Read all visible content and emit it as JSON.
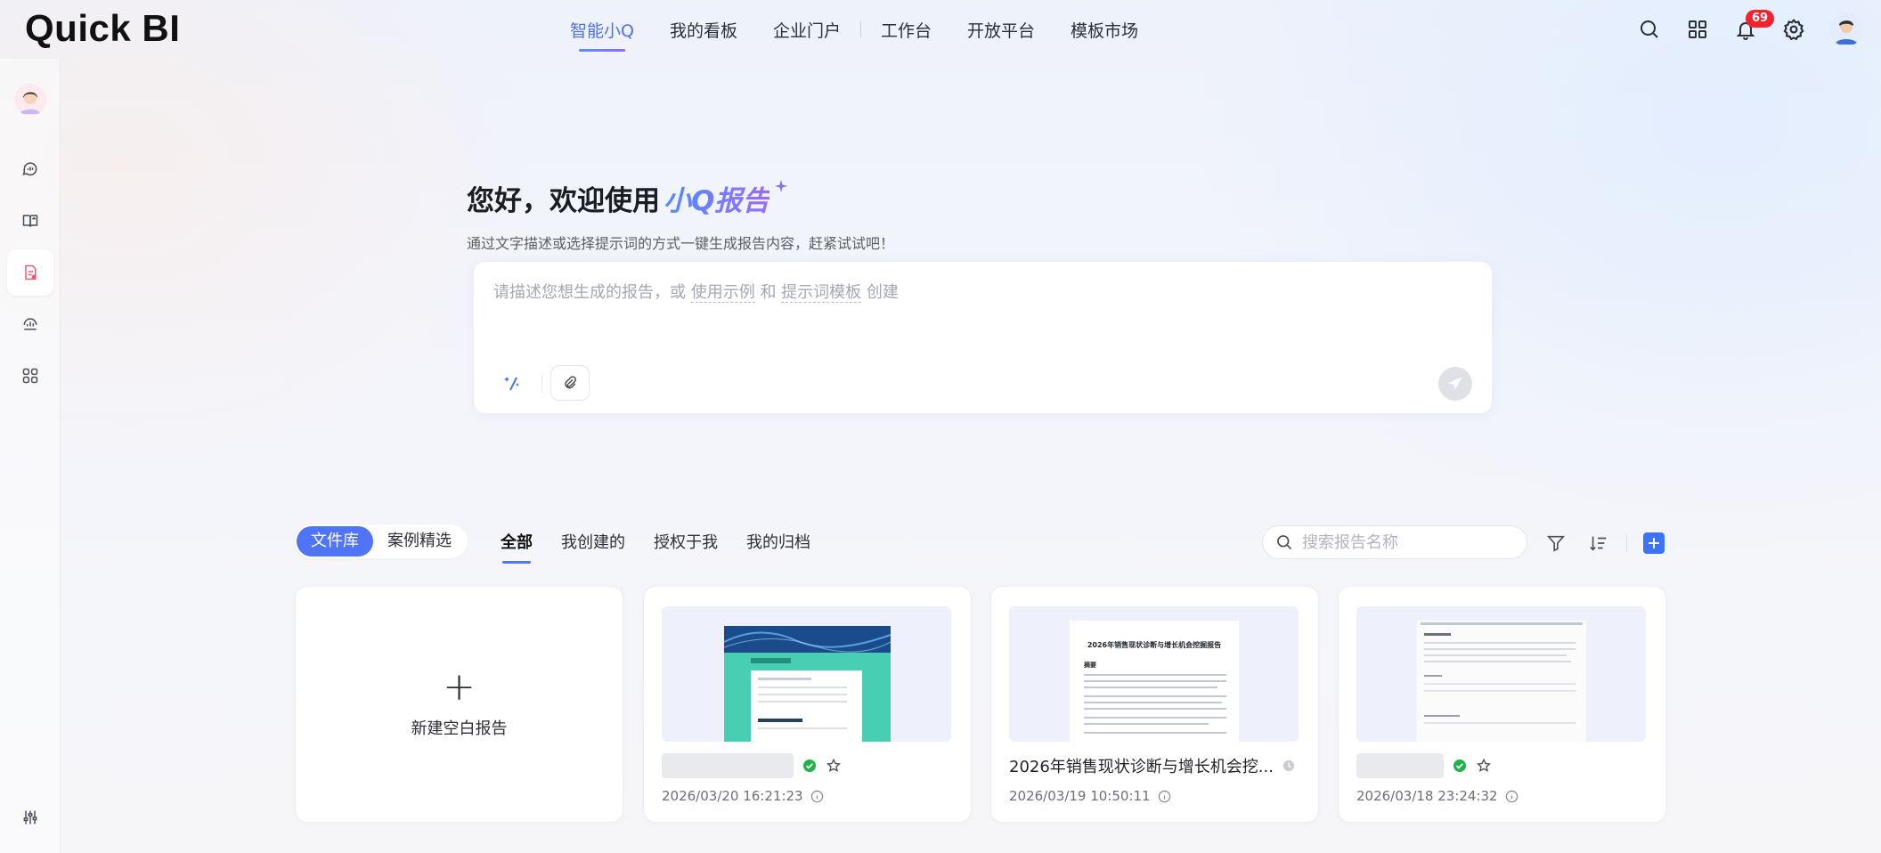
{
  "app": {
    "logo": "Quick BI"
  },
  "nav": {
    "items": [
      {
        "label": "智能小Q",
        "active": true
      },
      {
        "label": "我的看板"
      },
      {
        "label": "企业门户"
      },
      {
        "label": "工作台"
      },
      {
        "label": "开放平台"
      },
      {
        "label": "模板市场"
      }
    ]
  },
  "top_icons": {
    "notification_count": "69"
  },
  "sidebar": {
    "items": [
      {
        "icon": "chat-analysis-icon"
      },
      {
        "icon": "book-report-icon"
      },
      {
        "icon": "report-doc-icon",
        "active": true
      },
      {
        "icon": "insight-icon"
      },
      {
        "icon": "apps-icon"
      },
      {
        "icon": "sliders-icon"
      }
    ]
  },
  "hero": {
    "title_prefix": "您好，欢迎使用",
    "title_brand": "小Q报告",
    "subtitle": "通过文字描述或选择提示词的方式一键生成报告内容，赶紧试试吧！",
    "prompt_part1": "请描述您想生成的报告，或 ",
    "prompt_link1": "使用示例",
    "prompt_part2": " 和 ",
    "prompt_link2": "提示词模板",
    "prompt_part3": " 创建"
  },
  "library": {
    "segments": [
      {
        "label": "文件库",
        "active": true
      },
      {
        "label": "案例精选"
      }
    ],
    "tabs": [
      {
        "label": "全部",
        "active": true
      },
      {
        "label": "我创建的"
      },
      {
        "label": "授权于我"
      },
      {
        "label": "我的归档"
      }
    ],
    "search_placeholder": "搜索报告名称"
  },
  "cards": {
    "new_label": "新建空白报告",
    "items": [
      {
        "name": "",
        "date": "2026/03/20 16:21:23",
        "status": "published"
      },
      {
        "name": "2026年销售现状诊断与增长机会挖...",
        "date": "2026/03/19 10:50:11",
        "status": "pending",
        "thumb_title": "2026年销售现状诊断与增长机会挖掘报告",
        "thumb_heading": "摘要"
      },
      {
        "name": "",
        "date": "2026/03/18 23:24:32",
        "status": "published"
      }
    ]
  },
  "colors": {
    "accent": "#4f74f5",
    "brand_gradient_start": "#4f8cff",
    "brand_gradient_end": "#9a6cff",
    "badge": "#f5222d",
    "success": "#22b24c"
  }
}
